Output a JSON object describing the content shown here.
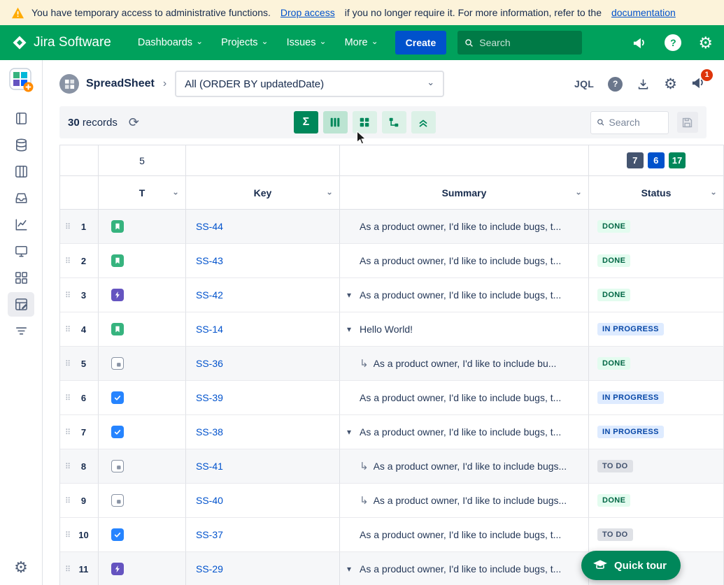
{
  "banner": {
    "text_before": "You have temporary access to administrative functions.",
    "drop_access_link": "Drop access",
    "text_middle": "if you no longer require it. For more information, refer to the",
    "documentation_link": "documentation"
  },
  "navbar": {
    "brand": "Jira Software",
    "menus": [
      {
        "label": "Dashboards"
      },
      {
        "label": "Projects"
      },
      {
        "label": "Issues"
      },
      {
        "label": "More"
      }
    ],
    "create_label": "Create",
    "search_placeholder": "Search"
  },
  "header": {
    "project_name": "SpreadSheet",
    "filter_dropdown_value": "All (ORDER BY updatedDate)",
    "jql_label": "JQL",
    "notification_count": "1"
  },
  "toolbar": {
    "records_count": "30",
    "records_label": "records",
    "search_placeholder": "Search"
  },
  "table": {
    "columns": [
      {
        "label": "T"
      },
      {
        "label": "Key"
      },
      {
        "label": "Summary"
      },
      {
        "label": "Status"
      }
    ],
    "stats": {
      "type_count": "5",
      "status_badges": [
        {
          "value": "7",
          "color": "#44546F"
        },
        {
          "value": "6",
          "color": "#0052CC"
        },
        {
          "value": "17",
          "color": "#00875A"
        }
      ]
    },
    "status_styles": {
      "DONE": {
        "bg": "#E3FCEF",
        "color": "#006644"
      },
      "IN PROGRESS": {
        "bg": "#DEEBFF",
        "color": "#0747A6"
      },
      "TO DO": {
        "bg": "#DFE1E6",
        "color": "#42526E"
      }
    },
    "rows": [
      {
        "num": "1",
        "type": "story",
        "key": "SS-44",
        "caret": false,
        "subtask": false,
        "summary": "As a product owner, I'd like to include bugs, t...",
        "status": "DONE",
        "shaded": true
      },
      {
        "num": "2",
        "type": "story",
        "key": "SS-43",
        "caret": false,
        "subtask": false,
        "summary": "As a product owner, I'd like to include bugs, t...",
        "status": "DONE",
        "shaded": false
      },
      {
        "num": "3",
        "type": "epic",
        "key": "SS-42",
        "caret": true,
        "subtask": false,
        "summary": "As a product owner, I'd like to include bugs, t...",
        "status": "DONE",
        "shaded": false
      },
      {
        "num": "4",
        "type": "story",
        "key": "SS-14",
        "caret": true,
        "subtask": false,
        "summary": "Hello World!",
        "status": "IN PROGRESS",
        "shaded": false
      },
      {
        "num": "5",
        "type": "subtask",
        "key": "SS-36",
        "caret": false,
        "subtask": true,
        "summary": "As a product owner, I'd like to include bu...",
        "status": "DONE",
        "shaded": true
      },
      {
        "num": "6",
        "type": "task",
        "key": "SS-39",
        "caret": false,
        "subtask": false,
        "summary": "As a product owner, I'd like to include bugs, t...",
        "status": "IN PROGRESS",
        "shaded": false
      },
      {
        "num": "7",
        "type": "task",
        "key": "SS-38",
        "caret": true,
        "subtask": false,
        "summary": "As a product owner, I'd like to include bugs, t...",
        "status": "IN PROGRESS",
        "shaded": false
      },
      {
        "num": "8",
        "type": "subtask",
        "key": "SS-41",
        "caret": false,
        "subtask": true,
        "summary": "As a product owner, I'd like to include bugs...",
        "status": "TO DO",
        "shaded": true
      },
      {
        "num": "9",
        "type": "subtask",
        "key": "SS-40",
        "caret": false,
        "subtask": true,
        "summary": "As a product owner, I'd like to include bugs...",
        "status": "DONE",
        "shaded": false
      },
      {
        "num": "10",
        "type": "task",
        "key": "SS-37",
        "caret": false,
        "subtask": false,
        "summary": "As a product owner, I'd like to include bugs, t...",
        "status": "TO DO",
        "shaded": false
      },
      {
        "num": "11",
        "type": "epic",
        "key": "SS-29",
        "caret": true,
        "subtask": false,
        "summary": "As a product owner, I'd like to include bugs, t...",
        "status": "",
        "shaded": true
      }
    ]
  },
  "quick_tour": {
    "label": "Quick tour"
  },
  "icons": {
    "chevron_down": "⌄",
    "breadcrumb_chevron": "›",
    "caret_expand": "▾",
    "subtask_arrow": "↳",
    "refresh": "⟳",
    "gear": "⚙",
    "sigma": "Σ",
    "question_mark": "?",
    "drag_handle": "⠿"
  }
}
